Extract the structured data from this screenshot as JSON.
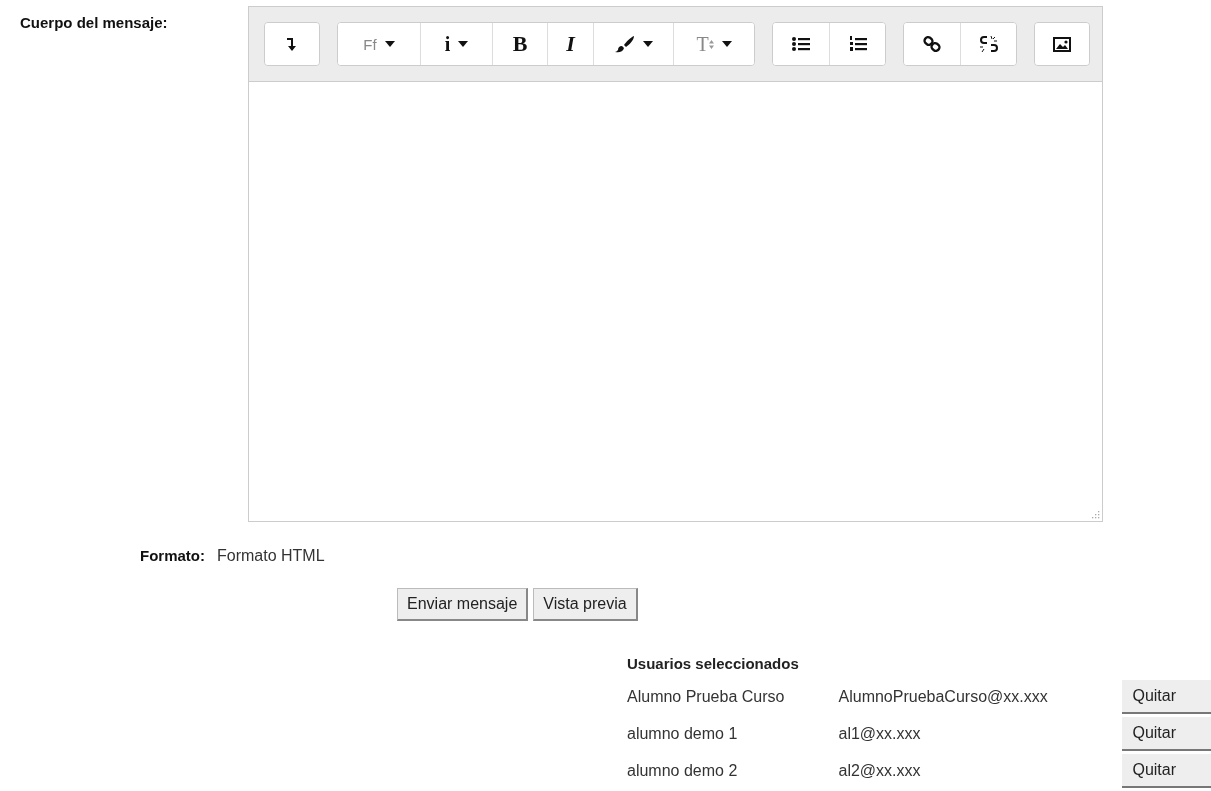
{
  "body_label": "Cuerpo del mensaje:",
  "toolbar": [
    {
      "buttons": [
        {
          "kind": "linebreak",
          "dropdown": false
        }
      ]
    },
    {
      "buttons": [
        {
          "kind": "font",
          "label": "Ff",
          "dropdown": true
        },
        {
          "kind": "info",
          "label": "i",
          "dropdown": true
        },
        {
          "kind": "bold",
          "label": "B",
          "dropdown": false
        },
        {
          "kind": "italic",
          "label": "I",
          "dropdown": false
        },
        {
          "kind": "color",
          "dropdown": true
        },
        {
          "kind": "size",
          "label": "T",
          "dropdown": true
        }
      ]
    },
    {
      "buttons": [
        {
          "kind": "bullets",
          "dropdown": false
        },
        {
          "kind": "numbers",
          "dropdown": false
        }
      ]
    },
    {
      "buttons": [
        {
          "kind": "link",
          "dropdown": false
        },
        {
          "kind": "unlink",
          "dropdown": false
        }
      ]
    },
    {
      "buttons": [
        {
          "kind": "image",
          "dropdown": false
        }
      ]
    }
  ],
  "format": {
    "label": "Formato:",
    "value": "Formato HTML"
  },
  "actions": [
    "Enviar mensaje",
    "Vista previa"
  ],
  "users": {
    "title": "Usuarios seleccionados",
    "rows": [
      {
        "name": "Alumno Prueba Curso",
        "email": "AlumnoPruebaCurso@xx.xxx",
        "button": "Quitar"
      },
      {
        "name": "alumno demo 1",
        "email": "al1@xx.xxx",
        "button": "Quitar"
      },
      {
        "name": "alumno demo 2",
        "email": "al2@xx.xxx",
        "button": "Quitar"
      }
    ]
  }
}
